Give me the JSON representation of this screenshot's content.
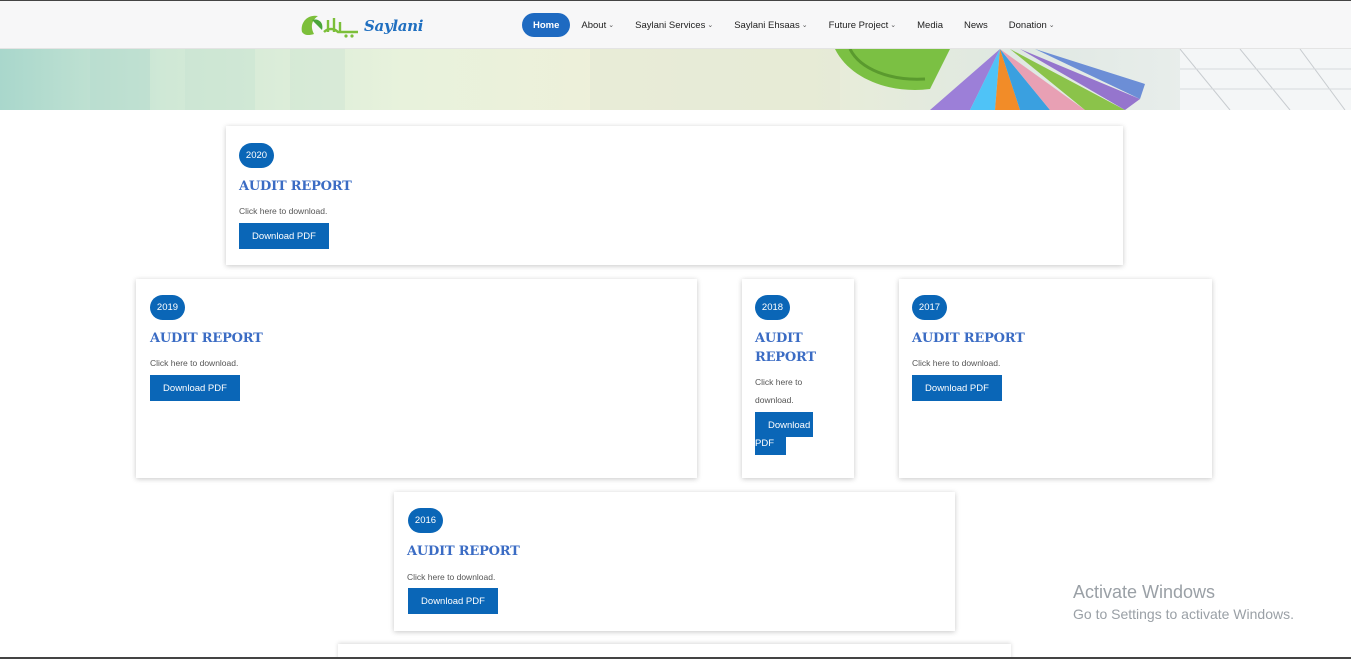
{
  "header": {
    "logo_text": "Saylani",
    "logo_urdu": "سیلانی",
    "nav": [
      {
        "label": "Home",
        "active": true,
        "dropdown": false
      },
      {
        "label": "About",
        "dropdown": true
      },
      {
        "label": "Saylani Services",
        "dropdown": true
      },
      {
        "label": "Saylani Ehsaas",
        "dropdown": true
      },
      {
        "label": "Future Project",
        "dropdown": true
      },
      {
        "label": "Media",
        "dropdown": false
      },
      {
        "label": "News",
        "dropdown": false
      },
      {
        "label": "Donation",
        "dropdown": true
      }
    ]
  },
  "reports": [
    {
      "year": "2020",
      "title": "AUDIT REPORT",
      "desc": "Click here to download.",
      "button": "Download PDF"
    },
    {
      "year": "2019",
      "title": "AUDIT REPORT",
      "desc": "Click here to download.",
      "button": "Download PDF"
    },
    {
      "year": "2018",
      "title": "AUDIT REPORT",
      "desc": "Click here to download.",
      "button": "Download PDF"
    },
    {
      "year": "2017",
      "title": "AUDIT REPORT",
      "desc": "Click here to download.",
      "button": "Download PDF"
    },
    {
      "year": "2016",
      "title": "AUDIT REPORT",
      "desc": "Click here to download.",
      "button": "Download PDF"
    }
  ],
  "watermark": {
    "line1": "Activate Windows",
    "line2": "Go to Settings to activate Windows."
  },
  "colors": {
    "primary": "#0a66b7",
    "title": "#3b6cc4"
  }
}
